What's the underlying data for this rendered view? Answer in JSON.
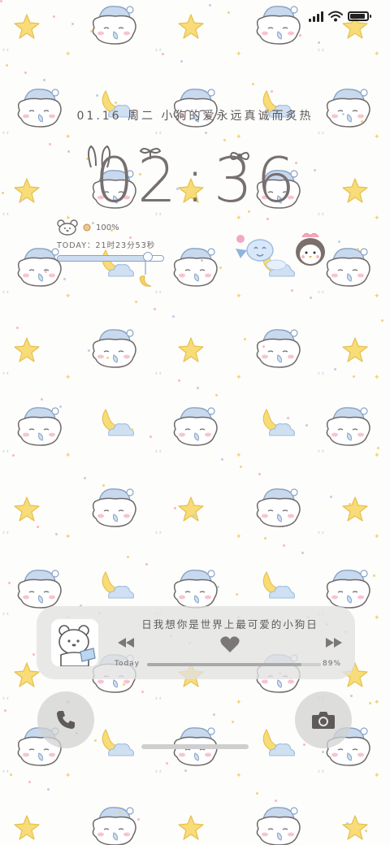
{
  "status_bar": {
    "signal_icon": "signal-bars-icon",
    "wifi_icon": "wifi-icon",
    "battery_icon": "battery-icon",
    "battery_level": 0.9
  },
  "date_line": "01.16 周二 小狗的爱永远真诚而炙热",
  "clock": {
    "hours": "02",
    "separator": ":",
    "minutes": "36"
  },
  "battery_widget": {
    "percent_label": "100%",
    "today_text": "TODAY：21时23分53秒",
    "level": 0.85
  },
  "music": {
    "song_title": "日我想你是世界上最可爱的小狗日",
    "progress_label": "Today",
    "progress_percent": "89%",
    "progress": 0.89,
    "prev_icon": "previous-track-icon",
    "like_icon": "heart-icon",
    "next_icon": "next-track-icon"
  },
  "quick_actions": {
    "phone_icon": "phone-icon",
    "camera_icon": "camera-icon"
  },
  "colors": {
    "accent_blue": "#8aa4c6",
    "star_yellow": "#f5d86a",
    "cloud_blue": "#b9d0ea",
    "text_gray": "#6f6a6a"
  }
}
